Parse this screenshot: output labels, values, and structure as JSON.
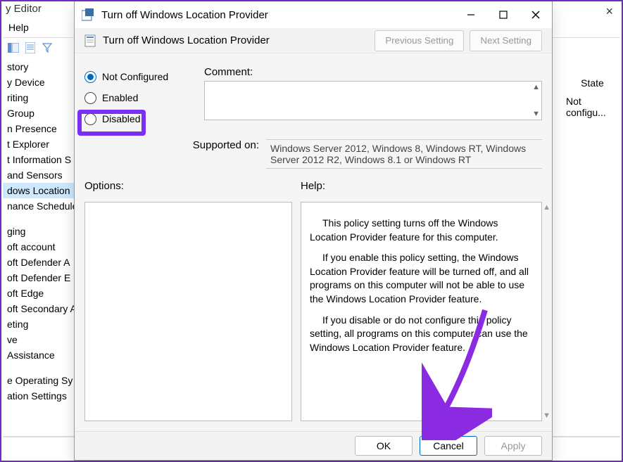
{
  "parent": {
    "title": "y Editor",
    "menu_help": "Help",
    "sidebar_items": [
      "story",
      "y Device",
      "riting",
      "Group",
      "n Presence",
      "t Explorer",
      "t Information S",
      "and Sensors",
      "dows Location",
      "nance Schedule"
    ],
    "sidebar_items2": [
      "ging",
      "oft account",
      "oft Defender A",
      "oft Defender E",
      "oft Edge",
      "oft Secondary A",
      "eting",
      "ve",
      " Assistance"
    ],
    "sidebar_items3": [
      "e Operating Sy",
      "ation Settings"
    ],
    "right_header": "State",
    "right_value": "Not configu..."
  },
  "dialog": {
    "title": "Turn off Windows Location Provider",
    "subtitle": "Turn off Windows Location Provider",
    "prev": "Previous Setting",
    "next": "Next Setting",
    "state_not_configured": "Not Configured",
    "state_enabled": "Enabled",
    "state_disabled": "Disabled",
    "comment_label": "Comment:",
    "supported_label": "Supported on:",
    "supported_text": "Windows Server 2012, Windows 8, Windows RT, Windows Server 2012 R2, Windows 8.1 or Windows RT",
    "options_label": "Options:",
    "help_label": "Help:",
    "help_p1": "This policy setting turns off the Windows Location Provider feature for this computer.",
    "help_p2": "If you enable this policy setting, the Windows Location Provider feature will be turned off, and all programs on this computer will not be able to use the Windows Location Provider feature.",
    "help_p3": "If you disable or do not configure this policy setting, all programs on this computer can use the Windows Location Provider feature.",
    "ok": "OK",
    "cancel": "Cancel",
    "apply": "Apply"
  }
}
